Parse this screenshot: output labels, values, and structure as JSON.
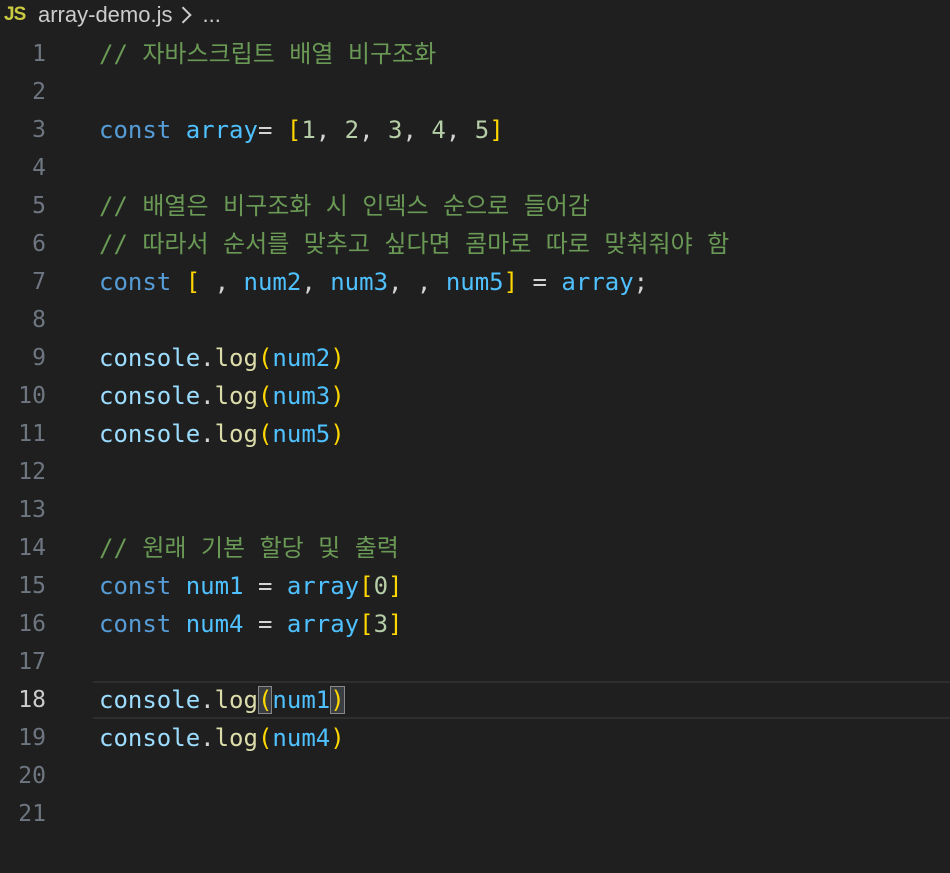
{
  "breadcrumb": {
    "icon": "JS",
    "file": "array-demo.js",
    "ellipsis": "..."
  },
  "colors": {
    "background": "#1f1f1f",
    "comment": "#6a9955",
    "keyword": "#569cd6",
    "variable": "#9cdcfe",
    "constant": "#4fc1ff",
    "number": "#b5cea8",
    "bracket": "#ffd700",
    "function": "#dcdcaa",
    "line_number": "#6e7681"
  },
  "editor": {
    "current_line": 18,
    "lines": [
      {
        "n": "1",
        "tokens": [
          {
            "t": "comment",
            "v": "// 자바스크립트 배열 비구조화"
          }
        ]
      },
      {
        "n": "2",
        "tokens": []
      },
      {
        "n": "3",
        "tokens": [
          {
            "t": "keyword",
            "v": "const "
          },
          {
            "t": "const",
            "v": "array"
          },
          {
            "t": "punc",
            "v": "= "
          },
          {
            "t": "br1",
            "v": "["
          },
          {
            "t": "num",
            "v": "1"
          },
          {
            "t": "punc",
            "v": ", "
          },
          {
            "t": "num",
            "v": "2"
          },
          {
            "t": "punc",
            "v": ", "
          },
          {
            "t": "num",
            "v": "3"
          },
          {
            "t": "punc",
            "v": ", "
          },
          {
            "t": "num",
            "v": "4"
          },
          {
            "t": "punc",
            "v": ", "
          },
          {
            "t": "num",
            "v": "5"
          },
          {
            "t": "br1",
            "v": "]"
          }
        ]
      },
      {
        "n": "4",
        "tokens": []
      },
      {
        "n": "5",
        "tokens": [
          {
            "t": "comment",
            "v": "// 배열은 비구조화 시 인덱스 순으로 들어감"
          }
        ]
      },
      {
        "n": "6",
        "tokens": [
          {
            "t": "comment",
            "v": "// 따라서 순서를 맞추고 싶다면 콤마로 따로 맞춰줘야 함"
          }
        ]
      },
      {
        "n": "7",
        "tokens": [
          {
            "t": "keyword",
            "v": "const "
          },
          {
            "t": "br1",
            "v": "["
          },
          {
            "t": "punc",
            "v": " , "
          },
          {
            "t": "const",
            "v": "num2"
          },
          {
            "t": "punc",
            "v": ", "
          },
          {
            "t": "const",
            "v": "num3"
          },
          {
            "t": "punc",
            "v": ", , "
          },
          {
            "t": "const",
            "v": "num5"
          },
          {
            "t": "br1",
            "v": "]"
          },
          {
            "t": "punc",
            "v": " = "
          },
          {
            "t": "const",
            "v": "array"
          },
          {
            "t": "punc",
            "v": ";"
          }
        ]
      },
      {
        "n": "8",
        "tokens": []
      },
      {
        "n": "9",
        "tokens": [
          {
            "t": "var",
            "v": "console"
          },
          {
            "t": "punc",
            "v": "."
          },
          {
            "t": "func",
            "v": "log"
          },
          {
            "t": "br1",
            "v": "("
          },
          {
            "t": "const",
            "v": "num2"
          },
          {
            "t": "br1",
            "v": ")"
          }
        ]
      },
      {
        "n": "10",
        "tokens": [
          {
            "t": "var",
            "v": "console"
          },
          {
            "t": "punc",
            "v": "."
          },
          {
            "t": "func",
            "v": "log"
          },
          {
            "t": "br1",
            "v": "("
          },
          {
            "t": "const",
            "v": "num3"
          },
          {
            "t": "br1",
            "v": ")"
          }
        ]
      },
      {
        "n": "11",
        "tokens": [
          {
            "t": "var",
            "v": "console"
          },
          {
            "t": "punc",
            "v": "."
          },
          {
            "t": "func",
            "v": "log"
          },
          {
            "t": "br1",
            "v": "("
          },
          {
            "t": "const",
            "v": "num5"
          },
          {
            "t": "br1",
            "v": ")"
          }
        ]
      },
      {
        "n": "12",
        "tokens": []
      },
      {
        "n": "13",
        "tokens": []
      },
      {
        "n": "14",
        "tokens": [
          {
            "t": "comment",
            "v": "// 원래 기본 할당 및 출력"
          }
        ]
      },
      {
        "n": "15",
        "tokens": [
          {
            "t": "keyword",
            "v": "const "
          },
          {
            "t": "const",
            "v": "num1"
          },
          {
            "t": "punc",
            "v": " = "
          },
          {
            "t": "const",
            "v": "array"
          },
          {
            "t": "br1",
            "v": "["
          },
          {
            "t": "num",
            "v": "0"
          },
          {
            "t": "br1",
            "v": "]"
          }
        ]
      },
      {
        "n": "16",
        "tokens": [
          {
            "t": "keyword",
            "v": "const "
          },
          {
            "t": "const",
            "v": "num4"
          },
          {
            "t": "punc",
            "v": " = "
          },
          {
            "t": "const",
            "v": "array"
          },
          {
            "t": "br1",
            "v": "["
          },
          {
            "t": "num",
            "v": "3"
          },
          {
            "t": "br1",
            "v": "]"
          }
        ]
      },
      {
        "n": "17",
        "tokens": []
      },
      {
        "n": "18",
        "tokens": [
          {
            "t": "var",
            "v": "console"
          },
          {
            "t": "punc",
            "v": "."
          },
          {
            "t": "func",
            "v": "log"
          },
          {
            "t": "br1-match",
            "v": "("
          },
          {
            "t": "const",
            "v": "num1"
          },
          {
            "t": "br1-match",
            "v": ")"
          }
        ]
      },
      {
        "n": "19",
        "tokens": [
          {
            "t": "var",
            "v": "console"
          },
          {
            "t": "punc",
            "v": "."
          },
          {
            "t": "func",
            "v": "log"
          },
          {
            "t": "br1",
            "v": "("
          },
          {
            "t": "const",
            "v": "num4"
          },
          {
            "t": "br1",
            "v": ")"
          }
        ]
      },
      {
        "n": "20",
        "tokens": []
      },
      {
        "n": "21",
        "tokens": []
      }
    ]
  }
}
